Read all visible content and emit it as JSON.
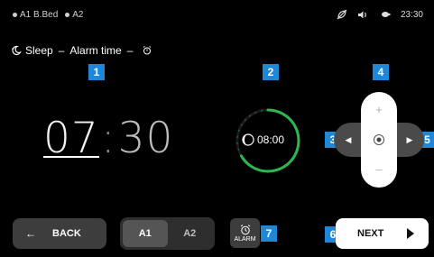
{
  "status": {
    "bed_primary": "A1 B.Bed",
    "bed_secondary": "A2",
    "time": "23:30",
    "icons": [
      "leaf-off-icon",
      "volume-icon",
      "battery-icon"
    ]
  },
  "title": {
    "part1": "Sleep",
    "sep1": "–",
    "part2": "Alarm time",
    "sep2": "–",
    "icon_moon": "moon-icon",
    "icon_alarm": "alarm-clock-icon"
  },
  "badges": [
    "1",
    "2",
    "3",
    "4",
    "5",
    "6",
    "7"
  ],
  "time_display": {
    "hours": "07",
    "separator": ":",
    "minutes": "30"
  },
  "ring": {
    "label": "08:00",
    "icon": "clock-moon-icon",
    "accent": "#2db84d"
  },
  "dpad": {
    "up": "+",
    "down": "–",
    "left": "◀",
    "right": "▶"
  },
  "bottom": {
    "back_label": "BACK",
    "back_arrow": "←",
    "seg_a1": "A1",
    "seg_a2": "A2",
    "alarm_label": "ALARM",
    "next_label": "NEXT"
  },
  "colors": {
    "badge": "#1e88d6",
    "ring_accent": "#2db84d"
  }
}
